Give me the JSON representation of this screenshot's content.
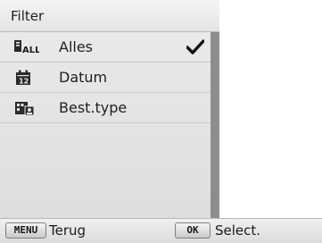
{
  "panel": {
    "title": "Filter"
  },
  "menu": {
    "items": [
      {
        "label": "Alles",
        "icon": "all-files-icon",
        "selected": true
      },
      {
        "label": "Datum",
        "icon": "calendar-date-icon",
        "selected": false
      },
      {
        "label": "Best.type",
        "icon": "file-type-icon",
        "selected": false
      }
    ]
  },
  "bottom_bar": {
    "back_key": "MENU",
    "back_label": "Terug",
    "select_key": "OK",
    "select_label": "Select."
  },
  "colors": {
    "panel_bg": "#e6e6e6",
    "scrollbar_thumb": "#8d8d8d",
    "text": "#1f1f1f"
  }
}
